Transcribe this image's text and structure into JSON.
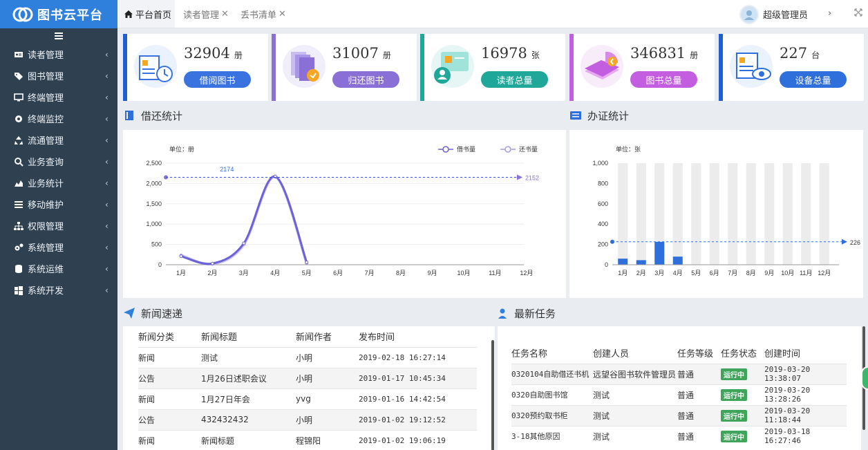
{
  "app": {
    "title": "图书云平台"
  },
  "sidebar": {
    "items": [
      {
        "label": "读者管理",
        "icon": "id-card-icon"
      },
      {
        "label": "图书管理",
        "icon": "tag-icon"
      },
      {
        "label": "终端管理",
        "icon": "monitor-icon"
      },
      {
        "label": "终端监控",
        "icon": "eye-icon"
      },
      {
        "label": "流通管理",
        "icon": "recycle-icon"
      },
      {
        "label": "业务查询",
        "icon": "search-icon"
      },
      {
        "label": "业务统计",
        "icon": "area-chart-icon"
      },
      {
        "label": "移动维护",
        "icon": "list-icon"
      },
      {
        "label": "权限管理",
        "icon": "sitemap-icon"
      },
      {
        "label": "系统管理",
        "icon": "cogs-icon"
      },
      {
        "label": "系统运维",
        "icon": "database-icon"
      },
      {
        "label": "系统开发",
        "icon": "windows-icon"
      }
    ]
  },
  "tabs": [
    {
      "label": "平台首页",
      "active": true
    },
    {
      "label": "读者管理",
      "close": "✕"
    },
    {
      "label": "丢书清单",
      "close": "✕"
    }
  ],
  "user": {
    "name": "超级管理员",
    "next": "›"
  },
  "stats": [
    {
      "value": "32904",
      "unit": "册",
      "label": "借阅图书",
      "color": "#3a73e0",
      "accent": "#1f5fd1"
    },
    {
      "value": "31007",
      "unit": "册",
      "label": "归还图书",
      "color": "#8a70d6",
      "accent": "#8a70d6"
    },
    {
      "value": "16978",
      "unit": "张",
      "label": "读者总量",
      "color": "#1fa79a",
      "accent": "#1fa79a"
    },
    {
      "value": "346831",
      "unit": "册",
      "label": "图书总量",
      "color": "#c35ee0",
      "accent": "#c35ee0"
    },
    {
      "value": "227",
      "unit": "台",
      "label": "设备总量",
      "color": "#2f6fdb",
      "accent": "#1f5fd1"
    }
  ],
  "borrow_panel": {
    "title": "借还统计"
  },
  "card_panel": {
    "title": "办证统计"
  },
  "news_panel": {
    "title": "新闻速递",
    "headers": [
      "新闻分类",
      "新闻标题",
      "新闻作者",
      "发布时间"
    ],
    "rows": [
      {
        "category": "新闻",
        "title": "测试",
        "author": "小明",
        "time": "2019-02-18 16:27:14"
      },
      {
        "category": "公告",
        "title": "1月26日述职会议",
        "author": "小明",
        "time": "2019-01-17 10:45:34"
      },
      {
        "category": "新闻",
        "title": "1月27日年会",
        "author": "yvg",
        "time": "2019-01-16 14:42:54"
      },
      {
        "category": "公告",
        "title": "432432432",
        "author": "小明",
        "time": "2019-01-02 19:12:52"
      },
      {
        "category": "新闻",
        "title": "新闻标题",
        "author": "程锦阳",
        "time": "2019-01-02 19:06:19"
      }
    ]
  },
  "task_panel": {
    "title": "最新任务",
    "headers": [
      "任务名称",
      "创建人员",
      "任务等级",
      "任务状态",
      "创建时间"
    ],
    "rows": [
      {
        "name": "0320104自助借还书机",
        "creator": "远望谷图书软件管理员",
        "level": "普通",
        "status": "运行中",
        "time": "2019-03-20 13:38:07"
      },
      {
        "name": "0320自助图书馆",
        "creator": "测试",
        "level": "普通",
        "status": "运行中",
        "time": "2019-03-20 13:28:26"
      },
      {
        "name": "0320预约取书柜",
        "creator": "测试",
        "level": "普通",
        "status": "运行中",
        "time": "2019-03-20 11:18:44"
      },
      {
        "name": "3-18其他原因",
        "creator": "测试",
        "level": "普通",
        "status": "运行中",
        "time": "2019-03-18 16:27:46"
      }
    ]
  },
  "chart_data": [
    {
      "type": "line",
      "unit_label": "单位：册",
      "categories": [
        "1月",
        "2月",
        "3月",
        "4月",
        "5月",
        "6月",
        "7月",
        "8月",
        "9月",
        "10月",
        "11月",
        "12月"
      ],
      "ylim": [
        0,
        2500
      ],
      "yticks": [
        "0",
        "500",
        "1,000",
        "1,500",
        "2,000",
        "2,500"
      ],
      "series": [
        {
          "name": "借书量",
          "color": "#6b62d8",
          "values": [
            210,
            30,
            530,
            2174,
            60,
            null,
            null,
            null,
            null,
            null,
            null,
            null
          ]
        },
        {
          "name": "还书量",
          "color": "#a89ae8",
          "values": [
            230,
            20,
            500,
            2160,
            40,
            null,
            null,
            null,
            null,
            null,
            null,
            null
          ]
        }
      ],
      "max_label": "2174",
      "markline": {
        "value": 2152,
        "label": "2152"
      },
      "legend": "top-right",
      "grid": true
    },
    {
      "type": "bar",
      "unit_label": "单位：张",
      "categories": [
        "1月",
        "2月",
        "3月",
        "4月",
        "5月",
        "6月",
        "7月",
        "8月",
        "9月",
        "10月",
        "11月",
        "12月"
      ],
      "ylim": [
        0,
        1000
      ],
      "yticks": [
        "0",
        "200",
        "400",
        "600",
        "800",
        "1,000"
      ],
      "values": [
        60,
        45,
        225,
        80,
        0,
        0,
        0,
        0,
        0,
        0,
        0,
        0
      ],
      "bar_color": "#2f6fdb",
      "background_color": "#ececec",
      "markline": {
        "value": 226,
        "label": "226"
      }
    }
  ]
}
